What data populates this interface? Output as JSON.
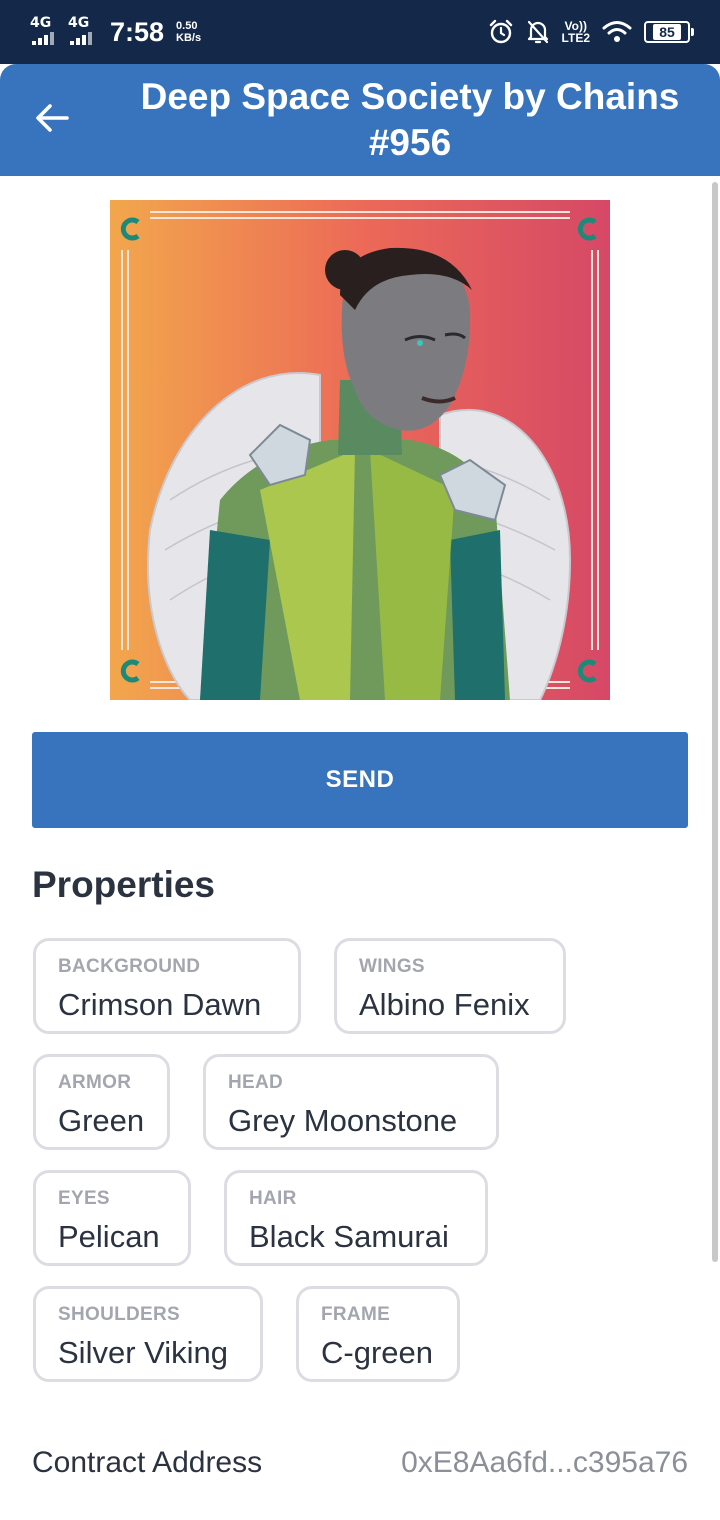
{
  "status_bar": {
    "network1": "4G",
    "network2": "4G",
    "time": "7:58",
    "speed_value": "0.50",
    "speed_unit": "KB/s",
    "volte_top": "Vo))",
    "volte_bottom": "LTE2",
    "battery": "85"
  },
  "header": {
    "title": "Deep Space Society by Chains #956",
    "back_icon": "arrow-left-icon"
  },
  "actions": {
    "send_label": "SEND"
  },
  "properties": {
    "title": "Properties",
    "items": [
      {
        "key": "BACKGROUND",
        "value": "Crimson Dawn"
      },
      {
        "key": "WINGS",
        "value": "Albino Fenix"
      },
      {
        "key": "ARMOR",
        "value": "Green"
      },
      {
        "key": "HEAD",
        "value": "Grey Moonstone"
      },
      {
        "key": "EYES",
        "value": "Pelican"
      },
      {
        "key": "HAIR",
        "value": "Black Samurai"
      },
      {
        "key": "SHOULDERS",
        "value": "Silver Viking"
      },
      {
        "key": "FRAME",
        "value": "C-green"
      }
    ]
  },
  "details": {
    "contract_label": "Contract Address",
    "contract_value": "0xE8Aa6fd...c395a76"
  },
  "colors": {
    "accent": "#3774bd",
    "status_bar": "#14294a",
    "text": "#2b3240",
    "muted": "#a3a6ae",
    "chip_border": "#dcdde2"
  }
}
